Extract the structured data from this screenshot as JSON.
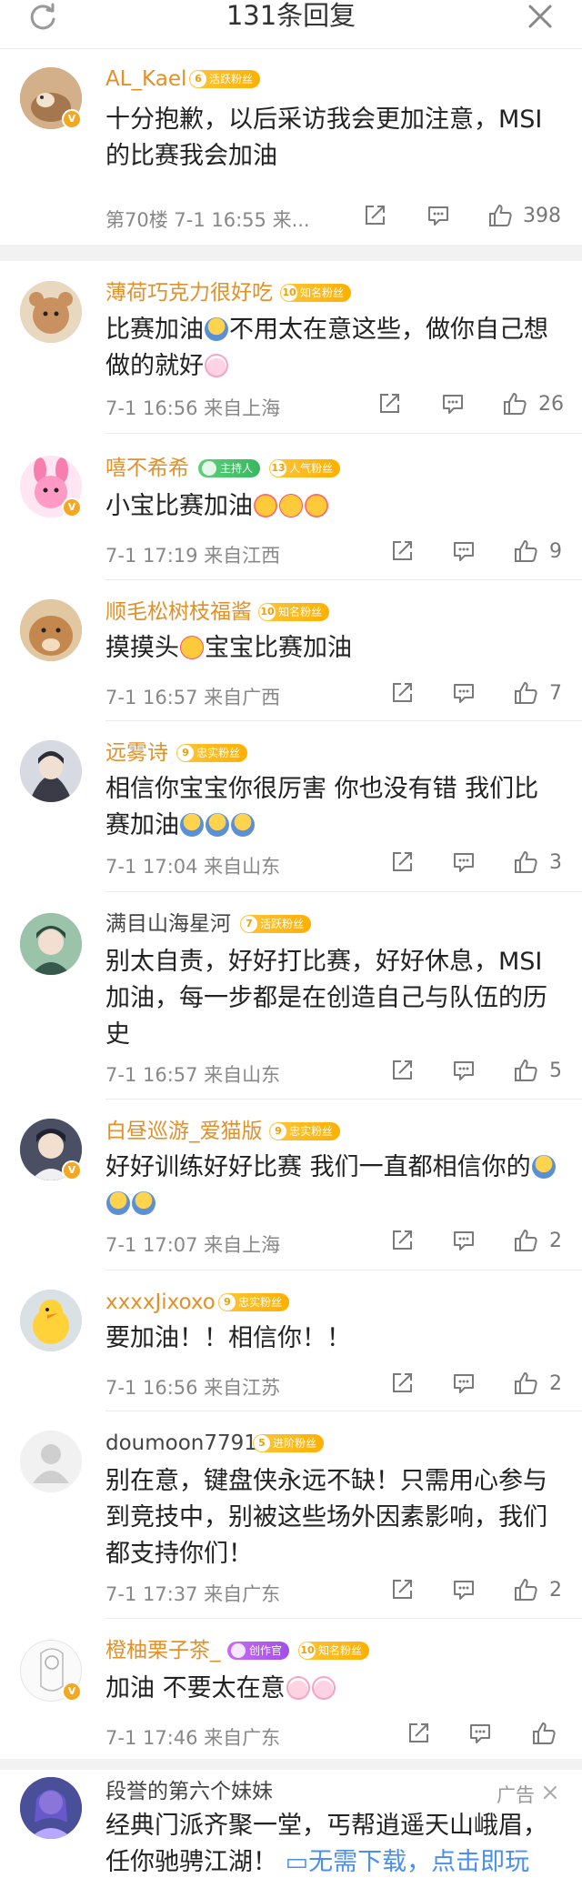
{
  "header": {
    "title": "131条回复"
  },
  "top_comment": {
    "username": "AL_Kael",
    "fan_level": "6",
    "fan_label": "活跃粉丝",
    "text_line1": "十分抱歉，以后采访我会更加注意，MSI",
    "text_line2": "的比赛我会加油",
    "meta": "第70楼 7-1 16:55 来...",
    "likes": "398"
  },
  "replies": [
    {
      "username": "薄荷巧克力很好吃",
      "fan_level": "10",
      "fan_label": "知名粉丝",
      "line1": "比赛加油",
      "line1b": "不用太在意这些，做你自己想",
      "line2": "做的就好",
      "meta": "7-1 16:56  来自上海",
      "likes": "26"
    },
    {
      "username": "嘻不希希",
      "tag1": "主持人",
      "fan_level": "13",
      "fan_label": "人气粉丝",
      "line1": "小宝比赛加油",
      "meta": "7-1 17:19  来自江西",
      "likes": "9"
    },
    {
      "username": "顺毛松树枝福酱",
      "fan_level": "10",
      "fan_label": "知名粉丝",
      "line1": "摸摸头",
      "line1b": "宝宝比赛加油",
      "meta": "7-1 16:57  来自广西",
      "likes": "7"
    },
    {
      "username": "远雾诗",
      "fan_level": "9",
      "fan_label": "忠实粉丝",
      "line1": "相信你宝宝你很厉害 你也没有错 我们比",
      "line2": "赛加油",
      "meta": "7-1 17:04  来自山东",
      "likes": "3"
    },
    {
      "username": "满目山海星河",
      "fan_level": "7",
      "fan_label": "活跃粉丝",
      "line1": "别太自责，好好打比赛，好好休息，MSI",
      "line2": "加油，每一步都是在创造自己与队伍的历",
      "line3": "史",
      "meta": "7-1 16:57  来自山东",
      "likes": "5"
    },
    {
      "username": "白昼巡游_爱猫版",
      "fan_level": "9",
      "fan_label": "忠实粉丝",
      "line1": "好好训练好好比赛 我们一直都相信你的",
      "meta": "7-1 17:07  来自上海",
      "likes": "2"
    },
    {
      "username": "xxxxJixoxo",
      "fan_level": "9",
      "fan_label": "忠实粉丝",
      "line1": "要加油！！相信你！！",
      "meta": "7-1 16:56  来自江苏",
      "likes": "2"
    },
    {
      "username": "doumoon7791",
      "fan_level": "5",
      "fan_label": "进阶粉丝",
      "line1": "别在意，键盘侠永远不缺！只需用心参与",
      "line2": "到竞技中，别被这些场外因素影响，我们",
      "line3": "都支持你们！",
      "meta": "7-1 17:37  来自广东",
      "likes": "2"
    },
    {
      "username": "橙柚栗子茶_",
      "tag1": "创作官",
      "fan_level": "10",
      "fan_label": "知名粉丝",
      "line1": "加油 不要太在意",
      "meta": "7-1 17:46  来自广东",
      "likes": ""
    }
  ],
  "ad": {
    "username": "段誉的第六个妹妹",
    "label": "广告",
    "line1": "经典门派齐聚一堂，丐帮逍遥天山峨眉，",
    "line2": "任你驰骋江湖！",
    "cta": "无需下载，点击即玩"
  },
  "icons": {
    "refresh": "refresh-icon",
    "close": "close-icon",
    "share": "share-icon",
    "comment": "comment-icon",
    "like": "thumb-up-icon"
  },
  "colors": {
    "name_orange": "#e2912a",
    "fan_badge": "#ffb000",
    "verified": "#f4a720",
    "cta_blue": "#4a8ff0"
  }
}
